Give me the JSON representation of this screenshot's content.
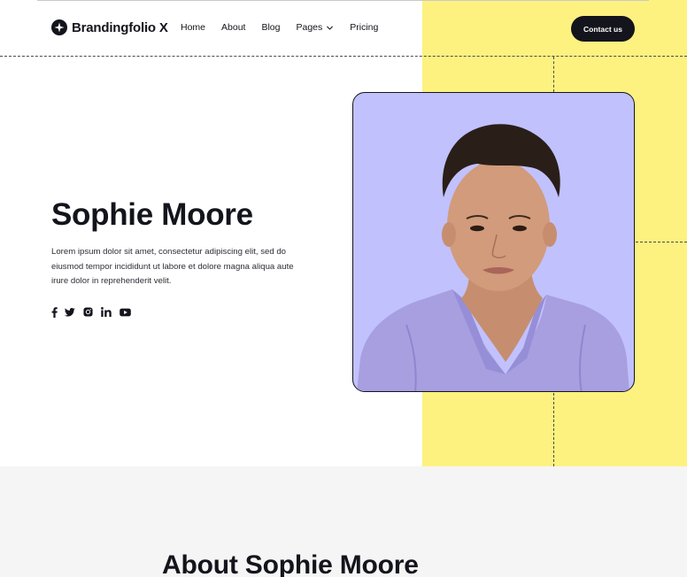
{
  "brand": {
    "name": "Brandingfolio X"
  },
  "nav": {
    "items": [
      "Home",
      "About",
      "Blog",
      "Pages",
      "Pricing"
    ],
    "cta_label": "Contact us"
  },
  "hero": {
    "name": "Sophie Moore",
    "description": "Lorem ipsum dolor sit amet, consectetur adipiscing elit, sed do eiusmod tempor incididunt ut labore et dolore magna aliqua aute irure dolor in reprehenderit velit.",
    "socials": [
      "facebook-icon",
      "twitter-icon",
      "instagram-icon",
      "linkedin-icon",
      "youtube-icon"
    ]
  },
  "about": {
    "title": "About Sophie Moore"
  },
  "colors": {
    "accent_yellow": "#fdf180",
    "photo_bg": "#c1c1fd",
    "text_dark": "#14141c",
    "section_gray": "#f5f5f5"
  }
}
